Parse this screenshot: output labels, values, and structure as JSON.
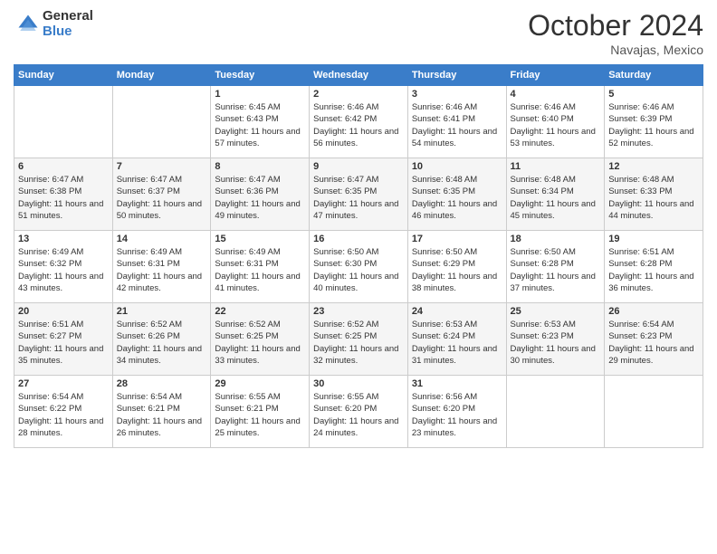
{
  "logo": {
    "general": "General",
    "blue": "Blue"
  },
  "header": {
    "month": "October 2024",
    "location": "Navajas, Mexico"
  },
  "days_of_week": [
    "Sunday",
    "Monday",
    "Tuesday",
    "Wednesday",
    "Thursday",
    "Friday",
    "Saturday"
  ],
  "weeks": [
    [
      {
        "day": "",
        "info": ""
      },
      {
        "day": "",
        "info": ""
      },
      {
        "day": "1",
        "info": "Sunrise: 6:45 AM\nSunset: 6:43 PM\nDaylight: 11 hours and 57 minutes."
      },
      {
        "day": "2",
        "info": "Sunrise: 6:46 AM\nSunset: 6:42 PM\nDaylight: 11 hours and 56 minutes."
      },
      {
        "day": "3",
        "info": "Sunrise: 6:46 AM\nSunset: 6:41 PM\nDaylight: 11 hours and 54 minutes."
      },
      {
        "day": "4",
        "info": "Sunrise: 6:46 AM\nSunset: 6:40 PM\nDaylight: 11 hours and 53 minutes."
      },
      {
        "day": "5",
        "info": "Sunrise: 6:46 AM\nSunset: 6:39 PM\nDaylight: 11 hours and 52 minutes."
      }
    ],
    [
      {
        "day": "6",
        "info": "Sunrise: 6:47 AM\nSunset: 6:38 PM\nDaylight: 11 hours and 51 minutes."
      },
      {
        "day": "7",
        "info": "Sunrise: 6:47 AM\nSunset: 6:37 PM\nDaylight: 11 hours and 50 minutes."
      },
      {
        "day": "8",
        "info": "Sunrise: 6:47 AM\nSunset: 6:36 PM\nDaylight: 11 hours and 49 minutes."
      },
      {
        "day": "9",
        "info": "Sunrise: 6:47 AM\nSunset: 6:35 PM\nDaylight: 11 hours and 47 minutes."
      },
      {
        "day": "10",
        "info": "Sunrise: 6:48 AM\nSunset: 6:35 PM\nDaylight: 11 hours and 46 minutes."
      },
      {
        "day": "11",
        "info": "Sunrise: 6:48 AM\nSunset: 6:34 PM\nDaylight: 11 hours and 45 minutes."
      },
      {
        "day": "12",
        "info": "Sunrise: 6:48 AM\nSunset: 6:33 PM\nDaylight: 11 hours and 44 minutes."
      }
    ],
    [
      {
        "day": "13",
        "info": "Sunrise: 6:49 AM\nSunset: 6:32 PM\nDaylight: 11 hours and 43 minutes."
      },
      {
        "day": "14",
        "info": "Sunrise: 6:49 AM\nSunset: 6:31 PM\nDaylight: 11 hours and 42 minutes."
      },
      {
        "day": "15",
        "info": "Sunrise: 6:49 AM\nSunset: 6:31 PM\nDaylight: 11 hours and 41 minutes."
      },
      {
        "day": "16",
        "info": "Sunrise: 6:50 AM\nSunset: 6:30 PM\nDaylight: 11 hours and 40 minutes."
      },
      {
        "day": "17",
        "info": "Sunrise: 6:50 AM\nSunset: 6:29 PM\nDaylight: 11 hours and 38 minutes."
      },
      {
        "day": "18",
        "info": "Sunrise: 6:50 AM\nSunset: 6:28 PM\nDaylight: 11 hours and 37 minutes."
      },
      {
        "day": "19",
        "info": "Sunrise: 6:51 AM\nSunset: 6:28 PM\nDaylight: 11 hours and 36 minutes."
      }
    ],
    [
      {
        "day": "20",
        "info": "Sunrise: 6:51 AM\nSunset: 6:27 PM\nDaylight: 11 hours and 35 minutes."
      },
      {
        "day": "21",
        "info": "Sunrise: 6:52 AM\nSunset: 6:26 PM\nDaylight: 11 hours and 34 minutes."
      },
      {
        "day": "22",
        "info": "Sunrise: 6:52 AM\nSunset: 6:25 PM\nDaylight: 11 hours and 33 minutes."
      },
      {
        "day": "23",
        "info": "Sunrise: 6:52 AM\nSunset: 6:25 PM\nDaylight: 11 hours and 32 minutes."
      },
      {
        "day": "24",
        "info": "Sunrise: 6:53 AM\nSunset: 6:24 PM\nDaylight: 11 hours and 31 minutes."
      },
      {
        "day": "25",
        "info": "Sunrise: 6:53 AM\nSunset: 6:23 PM\nDaylight: 11 hours and 30 minutes."
      },
      {
        "day": "26",
        "info": "Sunrise: 6:54 AM\nSunset: 6:23 PM\nDaylight: 11 hours and 29 minutes."
      }
    ],
    [
      {
        "day": "27",
        "info": "Sunrise: 6:54 AM\nSunset: 6:22 PM\nDaylight: 11 hours and 28 minutes."
      },
      {
        "day": "28",
        "info": "Sunrise: 6:54 AM\nSunset: 6:21 PM\nDaylight: 11 hours and 26 minutes."
      },
      {
        "day": "29",
        "info": "Sunrise: 6:55 AM\nSunset: 6:21 PM\nDaylight: 11 hours and 25 minutes."
      },
      {
        "day": "30",
        "info": "Sunrise: 6:55 AM\nSunset: 6:20 PM\nDaylight: 11 hours and 24 minutes."
      },
      {
        "day": "31",
        "info": "Sunrise: 6:56 AM\nSunset: 6:20 PM\nDaylight: 11 hours and 23 minutes."
      },
      {
        "day": "",
        "info": ""
      },
      {
        "day": "",
        "info": ""
      }
    ]
  ]
}
